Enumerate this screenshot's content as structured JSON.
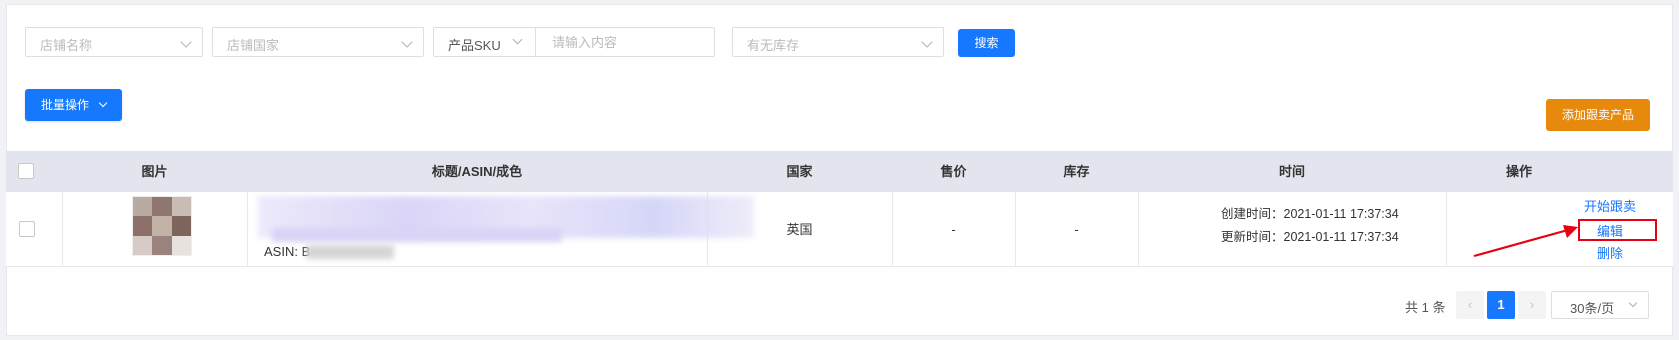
{
  "filters": {
    "store_name_placeholder": "店铺名称",
    "store_country_placeholder": "店铺国家",
    "sku_type_label": "产品SKU",
    "keyword_placeholder": "请输入内容",
    "stock_placeholder": "有无库存",
    "search_label": "搜索"
  },
  "toolbar": {
    "batch_label": "批量操作",
    "add_label": "添加跟卖产品"
  },
  "table": {
    "columns": [
      "图片",
      "标题/ASIN/成色",
      "国家",
      "售价",
      "库存",
      "时间",
      "操作"
    ],
    "rows": [
      {
        "title_partial": "Sorted Artificial Fl",
        "asin_label": "ASIN: B",
        "country": "英国",
        "price": "-",
        "stock": "-",
        "created": "创建时间：2021-01-11 17:37:34",
        "updated": "更新时间：2021-01-11 17:37:34",
        "actions": [
          "开始跟卖",
          "编辑",
          "删除"
        ]
      }
    ]
  },
  "pagination": {
    "total_text": "共 1 条",
    "current_page": "1",
    "page_size": "30条/页"
  },
  "colors": {
    "primary": "#1677ff",
    "accent_orange": "#e6890d",
    "highlight_red": "#e60012"
  }
}
